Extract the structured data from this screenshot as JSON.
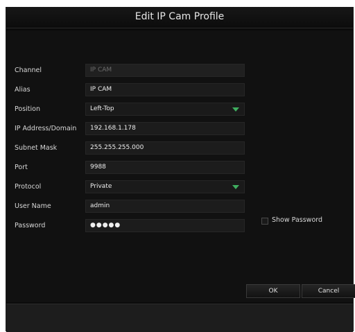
{
  "dialog": {
    "title": "Edit IP Cam Profile"
  },
  "form": {
    "channel": {
      "label": "Channel",
      "value": "IP CAM"
    },
    "alias": {
      "label": "Alias",
      "value": "IP CAM"
    },
    "position": {
      "label": "Position",
      "value": "Left-Top"
    },
    "ip_address": {
      "label": "IP Address/Domain",
      "value": "192.168.1.178"
    },
    "subnet_mask": {
      "label": "Subnet Mask",
      "value": "255.255.255.000"
    },
    "port": {
      "label": "Port",
      "value": "9988"
    },
    "protocol": {
      "label": "Protocol",
      "value": "Private"
    },
    "user_name": {
      "label": "User Name",
      "value": "admin"
    },
    "password": {
      "label": "Password",
      "value": "●●●●●"
    },
    "show_password_label": "Show Password"
  },
  "buttons": {
    "ok": "OK",
    "cancel": "Cancel"
  },
  "colors": {
    "background": "#0b0b0b",
    "field": "#1c1c1c",
    "text": "#e6e6e6",
    "accent_arrow": "#3fae5f"
  }
}
